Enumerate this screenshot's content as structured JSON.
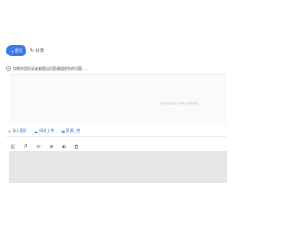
{
  "tabs": {
    "active": {
      "label": "提问",
      "icon": "plus-icon"
    },
    "second": {
      "label": "分享",
      "icon": "share-icon"
    }
  },
  "hint": {
    "icon": "clock-icon",
    "text": "如果你要投诉或者提出问题请描述你的问题……"
  },
  "editor": {
    "ghost_text": "请在此处输入你的问题描述"
  },
  "actions": {
    "insert_label": "插入图片",
    "upload_label": "网站上传",
    "share_label": "资源上传"
  },
  "colors": {
    "accent": "#3a7be6",
    "link": "#3a6fcc",
    "gray_bg": "#e6e6e6"
  }
}
